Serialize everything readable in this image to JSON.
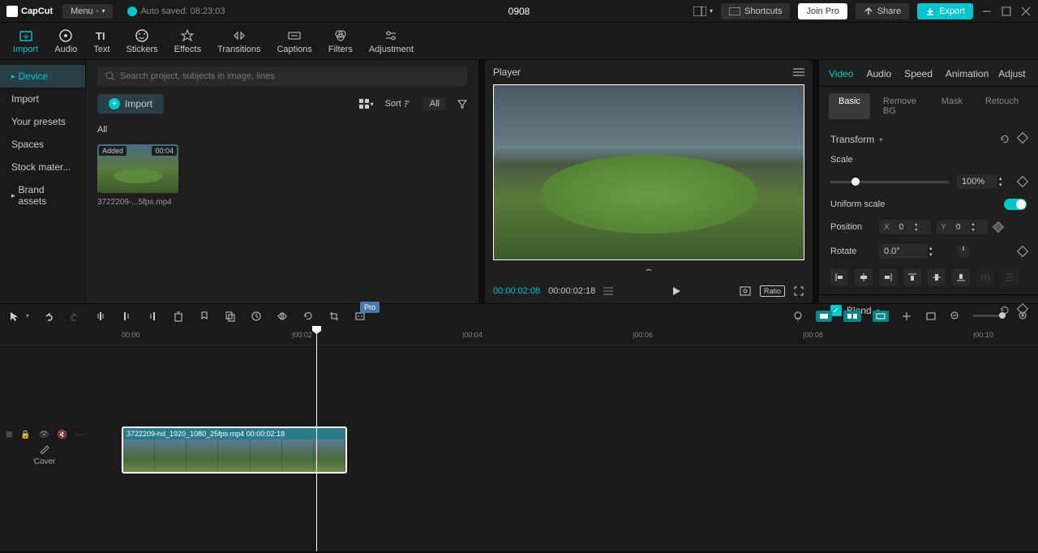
{
  "titlebar": {
    "app_name": "CapCut",
    "menu_label": "Menu",
    "autosave_text": "Auto saved: 08:23:03",
    "project_name": "0908",
    "shortcuts_label": "Shortcuts",
    "joinpro_label": "Join Pro",
    "share_label": "Share",
    "export_label": "Export"
  },
  "toolbar": {
    "import": "Import",
    "audio": "Audio",
    "text": "Text",
    "stickers": "Stickers",
    "effects": "Effects",
    "transitions": "Transitions",
    "captions": "Captions",
    "filters": "Filters",
    "adjustment": "Adjustment"
  },
  "sidebar": {
    "device": "Device",
    "import": "Import",
    "presets": "Your presets",
    "spaces": "Spaces",
    "stock": "Stock mater...",
    "brand": "Brand assets"
  },
  "media": {
    "search_placeholder": "Search project, subjects in image, lines",
    "import_label": "Import",
    "sort_label": "Sort",
    "all_label": "All",
    "tab_all": "All",
    "item": {
      "added": "Added",
      "duration": "00:04",
      "name": "3722209-...5fps.mp4"
    }
  },
  "player": {
    "title": "Player",
    "current_time": "00:00:02:08",
    "duration": "00:00:02:18",
    "ratio_label": "Ratio"
  },
  "props": {
    "tabs": {
      "video": "Video",
      "audio": "Audio",
      "speed": "Speed",
      "animation": "Animation",
      "adjust": "Adjust"
    },
    "subtabs": {
      "basic": "Basic",
      "removebg": "Remove BG",
      "mask": "Mask",
      "retouch": "Retouch"
    },
    "transform": "Transform",
    "scale": "Scale",
    "scale_value": "100%",
    "uniform_scale": "Uniform scale",
    "position": "Position",
    "pos_x_label": "X",
    "pos_x": "0",
    "pos_y_label": "Y",
    "pos_y": "0",
    "rotate": "Rotate",
    "rotate_value": "0.0°",
    "blend": "Blend"
  },
  "timeline": {
    "pro_badge": "Pro",
    "ticks": [
      "00:00",
      "|00:02",
      "|00:04",
      "|00:06",
      "|00:08",
      "|00:10"
    ],
    "cover_label": "Cover",
    "clip_label": "3722209-hd_1920_1080_25fps.mp4  00:00:02:18"
  }
}
